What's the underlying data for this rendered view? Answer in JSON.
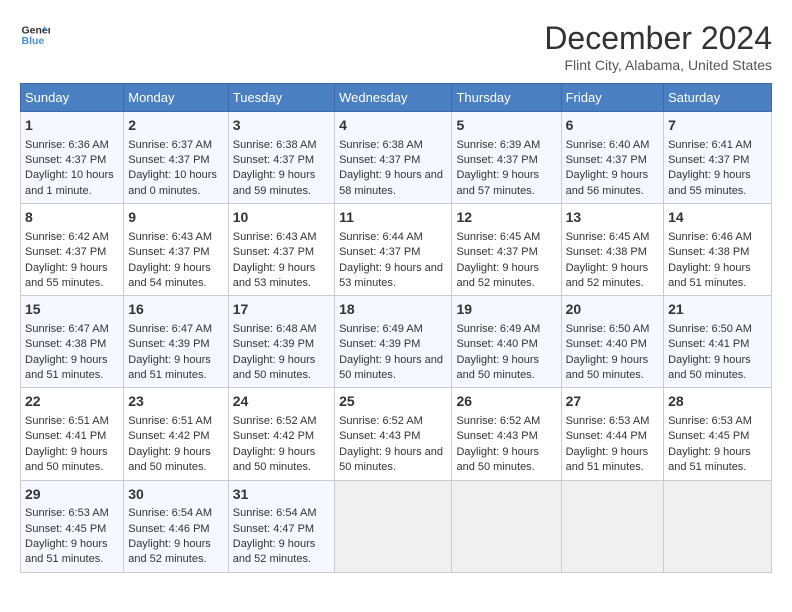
{
  "logo": {
    "line1": "General",
    "line2": "Blue"
  },
  "title": "December 2024",
  "subtitle": "Flint City, Alabama, United States",
  "header_days": [
    "Sunday",
    "Monday",
    "Tuesday",
    "Wednesday",
    "Thursday",
    "Friday",
    "Saturday"
  ],
  "weeks": [
    [
      {
        "day": "1",
        "sunrise": "6:36 AM",
        "sunset": "4:37 PM",
        "daylight": "10 hours and 1 minute."
      },
      {
        "day": "2",
        "sunrise": "6:37 AM",
        "sunset": "4:37 PM",
        "daylight": "10 hours and 0 minutes."
      },
      {
        "day": "3",
        "sunrise": "6:38 AM",
        "sunset": "4:37 PM",
        "daylight": "9 hours and 59 minutes."
      },
      {
        "day": "4",
        "sunrise": "6:38 AM",
        "sunset": "4:37 PM",
        "daylight": "9 hours and 58 minutes."
      },
      {
        "day": "5",
        "sunrise": "6:39 AM",
        "sunset": "4:37 PM",
        "daylight": "9 hours and 57 minutes."
      },
      {
        "day": "6",
        "sunrise": "6:40 AM",
        "sunset": "4:37 PM",
        "daylight": "9 hours and 56 minutes."
      },
      {
        "day": "7",
        "sunrise": "6:41 AM",
        "sunset": "4:37 PM",
        "daylight": "9 hours and 55 minutes."
      }
    ],
    [
      {
        "day": "8",
        "sunrise": "6:42 AM",
        "sunset": "4:37 PM",
        "daylight": "9 hours and 55 minutes."
      },
      {
        "day": "9",
        "sunrise": "6:43 AM",
        "sunset": "4:37 PM",
        "daylight": "9 hours and 54 minutes."
      },
      {
        "day": "10",
        "sunrise": "6:43 AM",
        "sunset": "4:37 PM",
        "daylight": "9 hours and 53 minutes."
      },
      {
        "day": "11",
        "sunrise": "6:44 AM",
        "sunset": "4:37 PM",
        "daylight": "9 hours and 53 minutes."
      },
      {
        "day": "12",
        "sunrise": "6:45 AM",
        "sunset": "4:37 PM",
        "daylight": "9 hours and 52 minutes."
      },
      {
        "day": "13",
        "sunrise": "6:45 AM",
        "sunset": "4:38 PM",
        "daylight": "9 hours and 52 minutes."
      },
      {
        "day": "14",
        "sunrise": "6:46 AM",
        "sunset": "4:38 PM",
        "daylight": "9 hours and 51 minutes."
      }
    ],
    [
      {
        "day": "15",
        "sunrise": "6:47 AM",
        "sunset": "4:38 PM",
        "daylight": "9 hours and 51 minutes."
      },
      {
        "day": "16",
        "sunrise": "6:47 AM",
        "sunset": "4:39 PM",
        "daylight": "9 hours and 51 minutes."
      },
      {
        "day": "17",
        "sunrise": "6:48 AM",
        "sunset": "4:39 PM",
        "daylight": "9 hours and 50 minutes."
      },
      {
        "day": "18",
        "sunrise": "6:49 AM",
        "sunset": "4:39 PM",
        "daylight": "9 hours and 50 minutes."
      },
      {
        "day": "19",
        "sunrise": "6:49 AM",
        "sunset": "4:40 PM",
        "daylight": "9 hours and 50 minutes."
      },
      {
        "day": "20",
        "sunrise": "6:50 AM",
        "sunset": "4:40 PM",
        "daylight": "9 hours and 50 minutes."
      },
      {
        "day": "21",
        "sunrise": "6:50 AM",
        "sunset": "4:41 PM",
        "daylight": "9 hours and 50 minutes."
      }
    ],
    [
      {
        "day": "22",
        "sunrise": "6:51 AM",
        "sunset": "4:41 PM",
        "daylight": "9 hours and 50 minutes."
      },
      {
        "day": "23",
        "sunrise": "6:51 AM",
        "sunset": "4:42 PM",
        "daylight": "9 hours and 50 minutes."
      },
      {
        "day": "24",
        "sunrise": "6:52 AM",
        "sunset": "4:42 PM",
        "daylight": "9 hours and 50 minutes."
      },
      {
        "day": "25",
        "sunrise": "6:52 AM",
        "sunset": "4:43 PM",
        "daylight": "9 hours and 50 minutes."
      },
      {
        "day": "26",
        "sunrise": "6:52 AM",
        "sunset": "4:43 PM",
        "daylight": "9 hours and 50 minutes."
      },
      {
        "day": "27",
        "sunrise": "6:53 AM",
        "sunset": "4:44 PM",
        "daylight": "9 hours and 51 minutes."
      },
      {
        "day": "28",
        "sunrise": "6:53 AM",
        "sunset": "4:45 PM",
        "daylight": "9 hours and 51 minutes."
      }
    ],
    [
      {
        "day": "29",
        "sunrise": "6:53 AM",
        "sunset": "4:45 PM",
        "daylight": "9 hours and 51 minutes."
      },
      {
        "day": "30",
        "sunrise": "6:54 AM",
        "sunset": "4:46 PM",
        "daylight": "9 hours and 52 minutes."
      },
      {
        "day": "31",
        "sunrise": "6:54 AM",
        "sunset": "4:47 PM",
        "daylight": "9 hours and 52 minutes."
      },
      null,
      null,
      null,
      null
    ]
  ]
}
